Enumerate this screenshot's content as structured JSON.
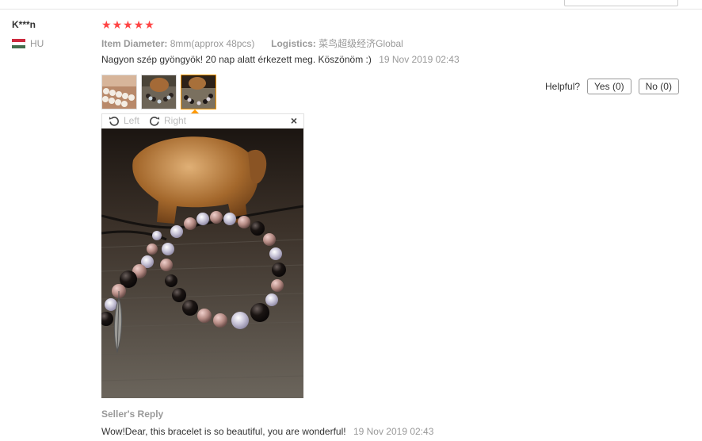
{
  "review": {
    "user": "K***n",
    "country_code": "HU",
    "rating": 5,
    "attributes": {
      "diameter_label": "Item Diameter:",
      "diameter_value": "8mm(approx 48pcs)",
      "logistics_label": "Logistics:",
      "logistics_value": "菜鸟超级经济Global"
    },
    "text": "Nagyon szép gyöngyök! 20 nap alatt érkezett meg. Köszönöm :)",
    "date": "19 Nov 2019 02:43",
    "helpful": {
      "label": "Helpful?",
      "yes": "Yes (0)",
      "no": "No (0)"
    },
    "viewer": {
      "left": "Left",
      "right": "Right",
      "close": "×"
    },
    "seller_reply": {
      "title": "Seller's Reply",
      "text": "Wow!Dear, this bracelet is so beautiful, you are wonderful!",
      "date": "19 Nov 2019 02:43"
    }
  },
  "colors": {
    "star": "#ff4444",
    "active_thumb_border": "#ff9900",
    "muted_text": "#999999"
  },
  "icons": [
    "rotate-left-icon",
    "rotate-right-icon",
    "close-icon",
    "star-icon",
    "hungary-flag-icon"
  ]
}
